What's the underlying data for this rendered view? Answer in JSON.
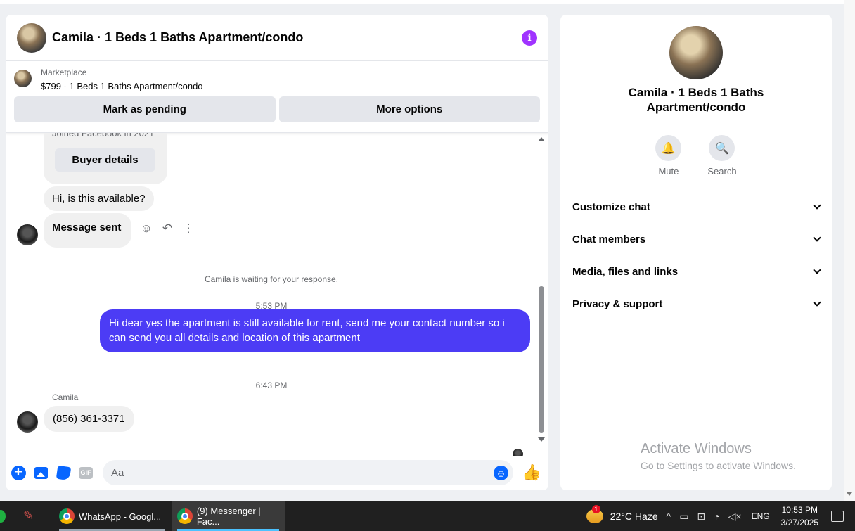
{
  "chat": {
    "title": "Camila · 1 Beds 1 Baths Apartment/condo",
    "marketplace_label": "Marketplace",
    "listing": "$799 - 1 Beds 1 Baths Apartment/condo",
    "mark_pending": "Mark as pending",
    "more_options": "More options",
    "joined_text": "Joined Facebook in 2021",
    "buyer_details": "Buyer details",
    "msg_available": "Hi, is this available?",
    "msg_sent": "Message sent",
    "waiting_note": "Camila is waiting for your response.",
    "time1": "5:53 PM",
    "outgoing_message": "Hi dear yes the apartment is still available for rent, send me your contact number so i can send you all details and location of this apartment",
    "time2": "6:43 PM",
    "sender_name": "Camila",
    "msg_phone": "(856) 361-3371",
    "input_placeholder": "Aa",
    "gif_label": "GIF"
  },
  "info_panel": {
    "name": "Camila · 1 Beds 1 Baths Apartment/condo",
    "mute": "Mute",
    "search": "Search",
    "sections": [
      "Customize chat",
      "Chat members",
      "Media, files and links",
      "Privacy & support"
    ],
    "activate_title": "Activate Windows",
    "activate_sub": "Go to Settings to activate Windows."
  },
  "taskbar": {
    "item1": "WhatsApp - Googl...",
    "item2": "(9) Messenger | Fac...",
    "weather": "22°C  Haze",
    "weather_badge": "1",
    "lang": "ENG",
    "time": "10:53 PM",
    "date": "3/27/2025"
  },
  "colors": {
    "accent_blue": "#0866ff",
    "outgoing_bubble": "#4c3cf5",
    "info_icon": "#a033ff"
  }
}
